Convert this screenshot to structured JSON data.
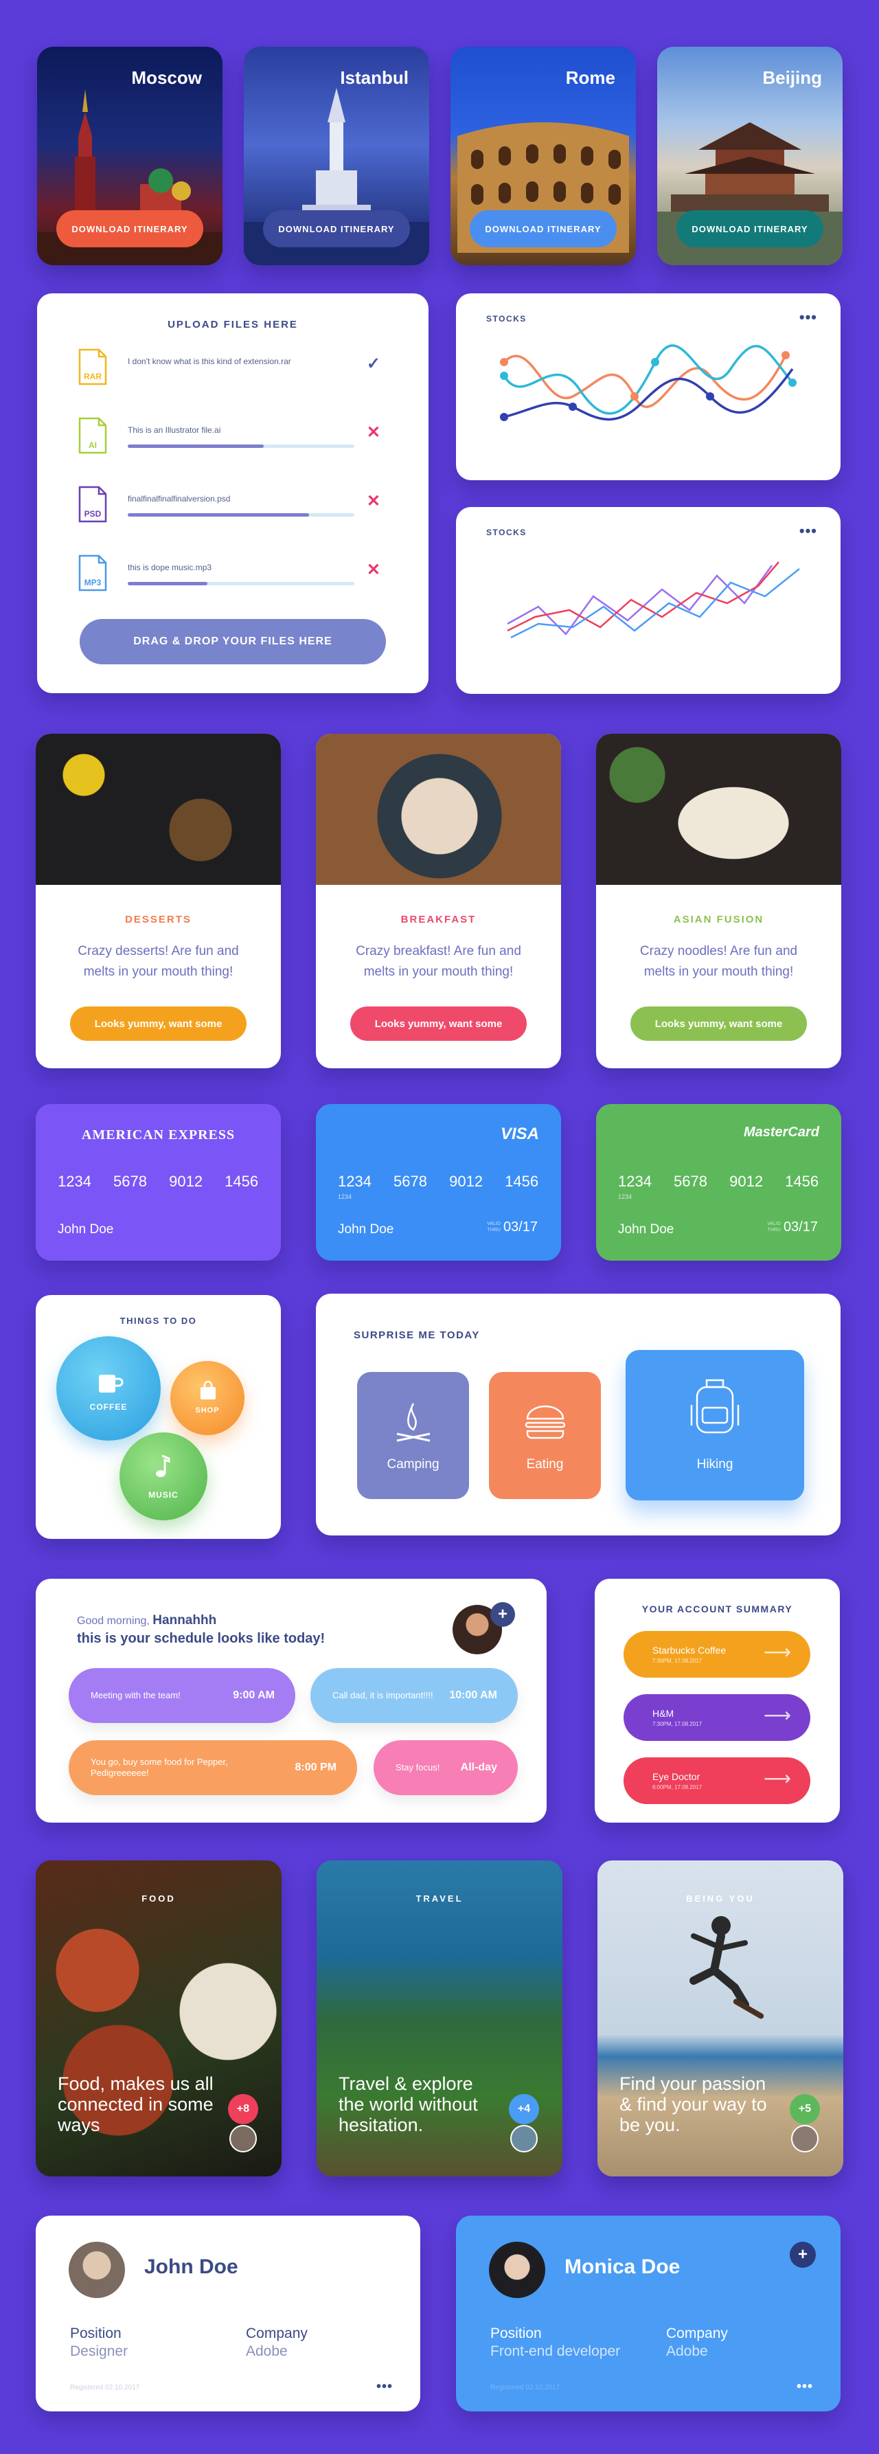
{
  "cities": [
    {
      "name": "Moscow",
      "button": "DOWNLOAD ITINERARY",
      "btn_color": "#ee5a3d"
    },
    {
      "name": "Istanbul",
      "button": "DOWNLOAD ITINERARY",
      "btn_color": "#3b4a9c"
    },
    {
      "name": "Rome",
      "button": "DOWNLOAD ITINERARY",
      "btn_color": "#4a8ff0"
    },
    {
      "name": "Beijing",
      "button": "DOWNLOAD ITINERARY",
      "btn_color": "#137a7a"
    }
  ],
  "upload": {
    "title": "UPLOAD FILES HERE",
    "files": [
      {
        "ext": "RAR",
        "name": "I don't know what is this kind of extension.rar",
        "progress": 1.0,
        "status": "done",
        "color": "#f3b61f"
      },
      {
        "ext": "AI",
        "name": "This is an Illustrator file.ai",
        "progress": 0.6,
        "status": "cancel",
        "color": "#a6cf39"
      },
      {
        "ext": "PSD",
        "name": "finalfinalfinalfinalversion.psd",
        "progress": 0.8,
        "status": "cancel",
        "color": "#6a3fb0"
      },
      {
        "ext": "MP3",
        "name": "this is dope music.mp3",
        "progress": 0.35,
        "status": "cancel",
        "color": "#4a9ae8"
      }
    ],
    "button": "DRAG & DROP YOUR FILES HERE"
  },
  "stocks": [
    {
      "title": "STOCKS",
      "more": "•••"
    },
    {
      "title": "STOCKS",
      "more": "•••"
    }
  ],
  "food": [
    {
      "category": "DESSERTS",
      "cat_color": "#f07c4a",
      "desc": "Crazy desserts! Are fun and melts in your mouth thing!",
      "button": "Looks yummy, want some",
      "btn_color": "#f4a21e"
    },
    {
      "category": "BREAKFAST",
      "cat_color": "#e84a6a",
      "desc": "Crazy breakfast! Are fun and melts in your mouth thing!",
      "button": "Looks yummy, want some",
      "btn_color": "#f04a6a"
    },
    {
      "category": "ASIAN FUSION",
      "cat_color": "#8cc152",
      "desc": "Crazy noodles! Are fun and melts in your mouth thing!",
      "button": "Looks yummy, want some",
      "btn_color": "#8cc152"
    }
  ],
  "cards": [
    {
      "brand": "AMERICAN EXPRESS",
      "number": "1234 5678 9012 1456",
      "holder": "John Doe",
      "color": "#7b55f5",
      "small": "",
      "valid": "",
      "valid_label": ""
    },
    {
      "brand": "VISA",
      "number": "1234 5678 9012 1456",
      "holder": "John Doe",
      "color": "#3a8ef5",
      "small": "1234",
      "valid": "03/17",
      "valid_label": "VALID THRU"
    },
    {
      "brand": "MasterCard",
      "number": "1234 5678 9012 1456",
      "holder": "John Doe",
      "color": "#5db85c",
      "small": "1234",
      "valid": "03/17",
      "valid_label": "VALID THRU"
    }
  ],
  "todo": {
    "title": "THINGS TO DO",
    "items": [
      {
        "label": "COFFEE"
      },
      {
        "label": "SHOP"
      },
      {
        "label": "MUSIC"
      }
    ]
  },
  "surprise": {
    "title": "SURPRISE ME TODAY",
    "items": [
      {
        "label": "Camping",
        "color": "#7b84c8"
      },
      {
        "label": "Eating",
        "color": "#f4875c"
      },
      {
        "label": "Hiking",
        "color": "#4a9cf5"
      }
    ]
  },
  "schedule": {
    "greeting": "Good morning,",
    "user": "Hannahhh",
    "subtitle": "this is your schedule looks like today!",
    "add": "+",
    "items": [
      {
        "text": "Meeting with the team!",
        "time": "9:00 AM"
      },
      {
        "text": "Call dad, it is important!!!!",
        "time": "10:00 AM"
      },
      {
        "text": "You go, buy some food for Pepper, Pedigreeeeee!",
        "time": "8:00 PM"
      },
      {
        "text": "Stay focus!",
        "time": "All-day"
      }
    ]
  },
  "account": {
    "title": "YOUR ACCOUNT SUMMARY",
    "items": [
      {
        "name": "Starbucks Coffee",
        "date": "7:30PM, 17.08.2017",
        "color": "#f4a21e"
      },
      {
        "name": "H&M",
        "date": "7:30PM, 17.08.2017",
        "color": "#7b3fd0"
      },
      {
        "name": "Eye Doctor",
        "date": "6:00PM, 17.08.2017",
        "color": "#ef3f5a"
      }
    ]
  },
  "stories": [
    {
      "label": "FOOD",
      "text": "Food, makes us all connected in some ways",
      "badge": "+8",
      "badge_color": "#ef3f5a"
    },
    {
      "label": "TRAVEL",
      "text": "Travel & explore the world without hesitation.",
      "badge": "+4",
      "badge_color": "#4a9cf5"
    },
    {
      "label": "BEING YOU",
      "text": "Find your passion & find your way to be you.",
      "badge": "+5",
      "badge_color": "#5db85c"
    }
  ],
  "profiles": [
    {
      "name": "John Doe",
      "position_label": "Position",
      "position": "Designer",
      "company_label": "Company",
      "company": "Adobe",
      "footer": "Registered 02.10.2017",
      "more": "•••",
      "add": ""
    },
    {
      "name": "Monica Doe",
      "position_label": "Position",
      "position": "Front-end developer",
      "company_label": "Company",
      "company": "Adobe",
      "footer": "Registered 02.10.2017",
      "more": "•••",
      "add": "+"
    }
  ]
}
